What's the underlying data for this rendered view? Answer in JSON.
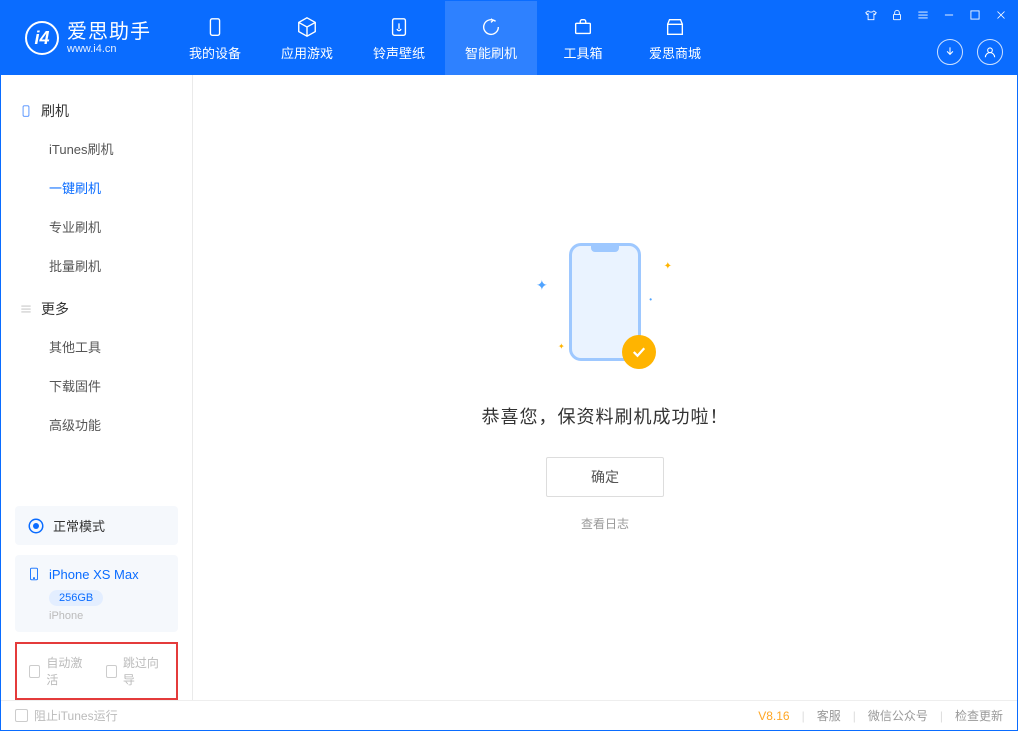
{
  "app": {
    "name_cn": "爱思助手",
    "name_en": "www.i4.cn"
  },
  "nav": {
    "items": [
      {
        "label": "我的设备",
        "icon": "device"
      },
      {
        "label": "应用游戏",
        "icon": "cube"
      },
      {
        "label": "铃声壁纸",
        "icon": "music"
      },
      {
        "label": "智能刷机",
        "icon": "refresh",
        "active": true
      },
      {
        "label": "工具箱",
        "icon": "toolbox"
      },
      {
        "label": "爱思商城",
        "icon": "store"
      }
    ]
  },
  "sidebar": {
    "section1": {
      "title": "刷机",
      "items": [
        "iTunes刷机",
        "一键刷机",
        "专业刷机",
        "批量刷机"
      ],
      "active_index": 1
    },
    "section2": {
      "title": "更多",
      "items": [
        "其他工具",
        "下载固件",
        "高级功能"
      ]
    },
    "mode": "正常模式",
    "device": {
      "name": "iPhone XS Max",
      "capacity": "256GB",
      "type": "iPhone"
    },
    "checkboxes": {
      "auto_activate": "自动激活",
      "skip_guide": "跳过向导"
    }
  },
  "main": {
    "success_msg": "恭喜您，保资料刷机成功啦！",
    "ok_button": "确定",
    "log_link": "查看日志"
  },
  "footer": {
    "block_itunes": "阻止iTunes运行",
    "version": "V8.16",
    "support": "客服",
    "wechat": "微信公众号",
    "update": "检查更新"
  }
}
